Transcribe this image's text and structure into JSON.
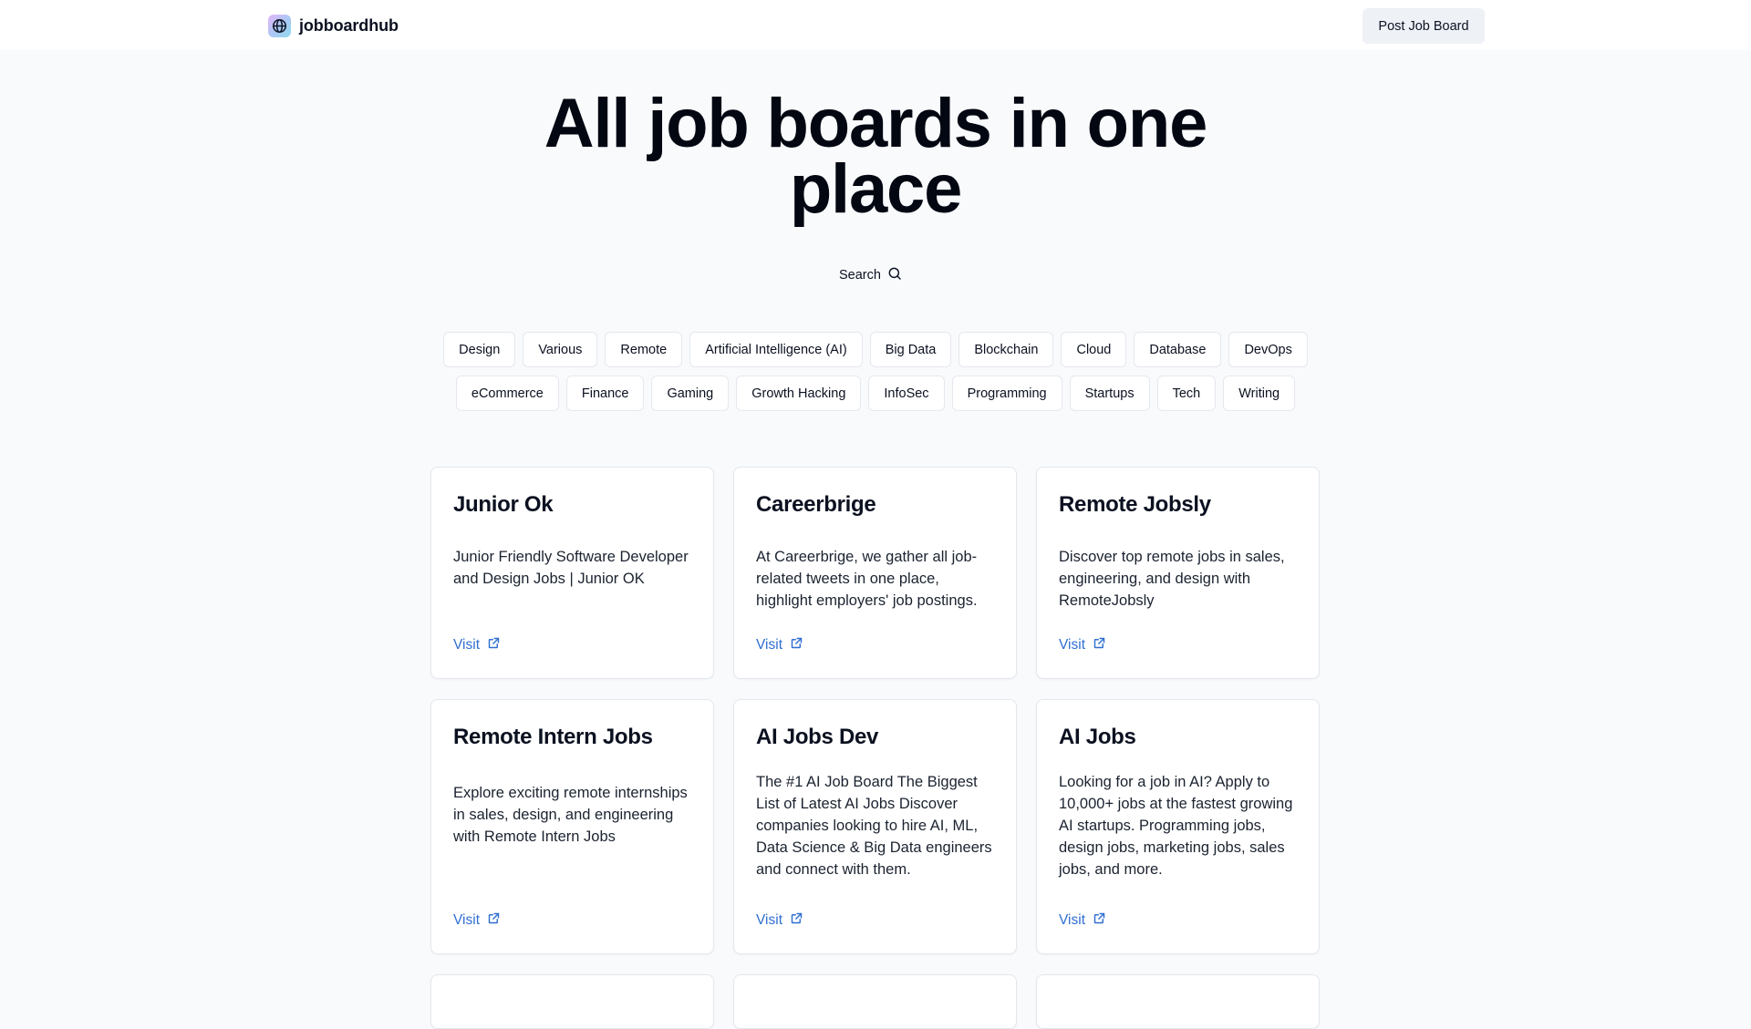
{
  "header": {
    "brand_name": "jobboardhub",
    "logo_icon": "globe-icon",
    "post_button_label": "Post Job Board"
  },
  "hero": {
    "title_line1": "All job boards in one",
    "title_line2": "place",
    "search_label": "Search",
    "search_icon": "search-icon"
  },
  "tags": [
    {
      "label": "Design"
    },
    {
      "label": "Various"
    },
    {
      "label": "Remote"
    },
    {
      "label": "Artificial Intelligence (AI)"
    },
    {
      "label": "Big Data"
    },
    {
      "label": "Blockchain"
    },
    {
      "label": "Cloud"
    },
    {
      "label": "Database"
    },
    {
      "label": "DevOps"
    },
    {
      "label": "eCommerce"
    },
    {
      "label": "Finance"
    },
    {
      "label": "Gaming"
    },
    {
      "label": "Growth Hacking"
    },
    {
      "label": "InfoSec"
    },
    {
      "label": "Programming"
    },
    {
      "label": "Startups"
    },
    {
      "label": "Tech"
    },
    {
      "label": "Writing"
    }
  ],
  "cards": [
    {
      "title": "Junior Ok",
      "description": "Junior Friendly Software Developer and Design Jobs | Junior OK",
      "link_label": "Visit"
    },
    {
      "title": "Careerbrige",
      "description": "At Careerbrige, we gather all job-related tweets in one place, highlight employers' job postings.",
      "link_label": "Visit"
    },
    {
      "title": "Remote Jobsly",
      "description": "Discover top remote jobs in sales, engineering, and design with RemoteJobsly",
      "link_label": "Visit"
    },
    {
      "title": "Remote Intern Jobs",
      "description": "Explore exciting remote internships in sales, design, and engineering with Remote Intern Jobs",
      "link_label": "Visit"
    },
    {
      "title": "AI Jobs Dev",
      "description": "The #1 AI Job Board The Biggest List of Latest AI Jobs Discover companies looking to hire AI, ML, Data Science & Big Data engineers and connect with them.",
      "link_label": "Visit"
    },
    {
      "title": "AI Jobs",
      "description": "Looking for a job in AI? Apply to 10,000+ jobs at the fastest growing AI startups. Programming jobs, design jobs, marketing jobs, sales jobs, and more.",
      "link_label": "Visit"
    }
  ],
  "colors": {
    "page_background": "#f8fafc",
    "header_background": "#ffffff",
    "text_primary": "#0b1120",
    "link_accent": "#2f6fd0",
    "button_background": "#eef1f6",
    "card_border": "#e3e7ed"
  }
}
